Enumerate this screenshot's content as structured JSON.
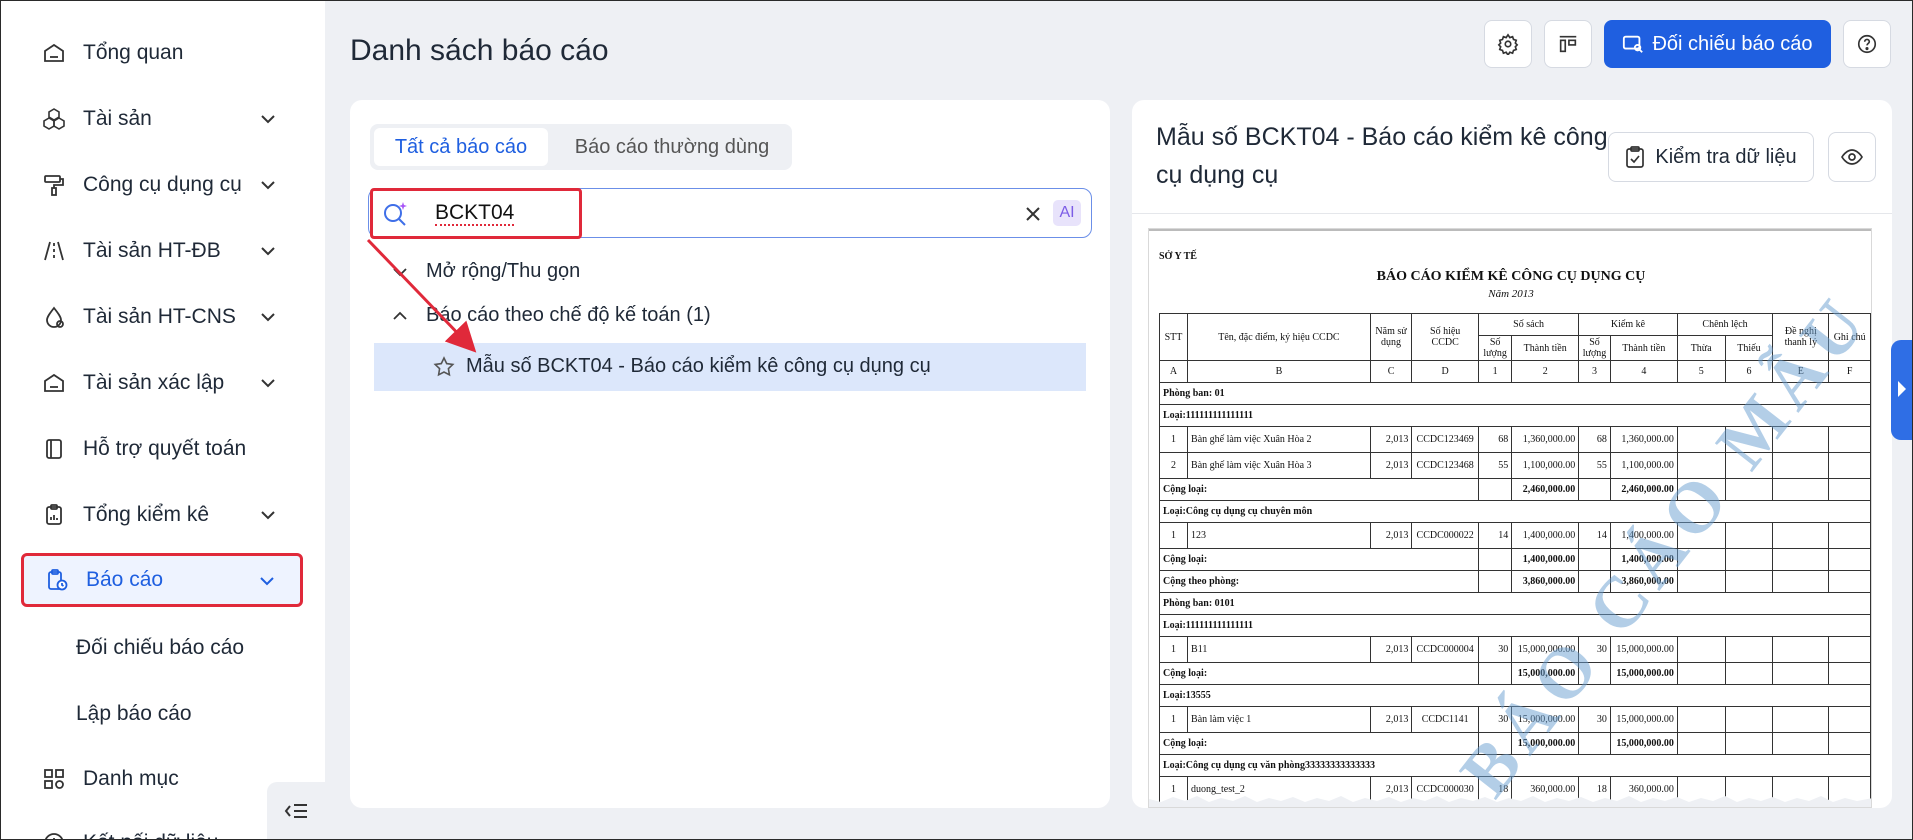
{
  "sidebar": {
    "items": [
      {
        "label": "Tổng quan",
        "icon": "home-icon"
      },
      {
        "label": "Tài sản",
        "icon": "cubes-icon"
      },
      {
        "label": "Công cụ dụng cụ",
        "icon": "paint-roller-icon"
      },
      {
        "label": "Tài sản HT-ĐB",
        "icon": "road-icon"
      },
      {
        "label": "Tài sản HT-CNS",
        "icon": "water-drop-icon"
      },
      {
        "label": "Tài sản xác lập",
        "icon": "house-icon"
      },
      {
        "label": "Hỗ trợ quyết toán",
        "icon": "notebook-icon"
      },
      {
        "label": "Tổng kiểm kê",
        "icon": "clipboard-chart-icon"
      },
      {
        "label": "Báo cáo",
        "icon": "report-clock-icon"
      },
      {
        "label": "Danh mục",
        "icon": "grid-icon"
      },
      {
        "label": "Kết nối dữ liệu",
        "icon": "clock-icon"
      }
    ],
    "sub_items": [
      "Đối chiếu báo cáo",
      "Lập báo cáo"
    ]
  },
  "header": {
    "title": "Danh sách báo cáo",
    "primary_button": "Đối chiếu báo cáo",
    "accent": "#1f5fe0"
  },
  "left_panel": {
    "tabs": [
      "Tất cả báo cáo",
      "Báo cáo thường dùng"
    ],
    "search": {
      "value": "BCKT04",
      "ai_label": "AI"
    },
    "tree": {
      "expand_label": "Mở rộng/Thu gọn",
      "group_label": "Báo cáo theo chế độ kế toán (1)",
      "item_label": "Mẫu số BCKT04 - Báo cáo kiểm kê công cụ dụng cụ"
    }
  },
  "right_panel": {
    "title": "Mẫu số BCKT04 - Báo cáo kiểm kê công cụ dụng cụ",
    "check_button": "Kiểm tra dữ liệu",
    "preview": {
      "org": "SỞ Y TẾ",
      "title": "BÁO CÁO KIỂM KÊ CÔNG CỤ DỤNG CỤ",
      "year": "Năm 2013",
      "watermark": "BÁO CÁO MẪU",
      "headers": {
        "stt": "STT",
        "name": "Tên, đặc điểm, ký hiệu CCDC",
        "year_used": "Năm sử dụng",
        "code": "Số hiệu CCDC",
        "book": "Số sách",
        "check": "Kiểm kê",
        "diff": "Chênh lệch",
        "proposal": "Đề nghị thanh lý",
        "note": "Ghi chú",
        "qty": "Số lượng",
        "amount": "Thành tiền",
        "surplus": "Thừa",
        "shortage": "Thiếu"
      },
      "letters": [
        "A",
        "B",
        "C",
        "D",
        "1",
        "2",
        "3",
        "4",
        "5",
        "6",
        "E",
        "F"
      ],
      "rows": [
        {
          "type": "group",
          "text": "Phòng ban: 01"
        },
        {
          "type": "group",
          "text": "Loại:111111111111111"
        },
        {
          "type": "item",
          "stt": "1",
          "name": "Bàn ghế làm việc Xuân Hòa 2",
          "year": "2,013",
          "code": "CCDC123469",
          "bq": "68",
          "ba": "1,360,000.00",
          "cq": "68",
          "ca": "1,360,000.00"
        },
        {
          "type": "item",
          "stt": "2",
          "name": "Bàn ghế làm việc Xuân Hòa 3",
          "year": "2,013",
          "code": "CCDC123468",
          "bq": "55",
          "ba": "1,100,000.00",
          "cq": "55",
          "ca": "1,100,000.00"
        },
        {
          "type": "sum",
          "text": "Cộng loại:",
          "ba": "2,460,000.00",
          "ca": "2,460,000.00"
        },
        {
          "type": "group",
          "text": "Loại:Công cụ dụng cụ chuyên môn"
        },
        {
          "type": "item",
          "stt": "1",
          "name": "123",
          "year": "2,013",
          "code": "CCDC000022",
          "bq": "14",
          "ba": "1,400,000.00",
          "cq": "14",
          "ca": "1,400,000.00"
        },
        {
          "type": "sum",
          "text": "Cộng loại:",
          "ba": "1,400,000.00",
          "ca": "1,400,000.00"
        },
        {
          "type": "sum",
          "text": "Cộng theo phòng:",
          "ba": "3,860,000.00",
          "ca": "3,860,000.00"
        },
        {
          "type": "group",
          "text": "Phòng ban: 0101"
        },
        {
          "type": "group",
          "text": "Loại:111111111111111"
        },
        {
          "type": "item",
          "stt": "1",
          "name": "B11",
          "year": "2,013",
          "code": "CCDC000004",
          "bq": "30",
          "ba": "15,000,000.00",
          "cq": "30",
          "ca": "15,000,000.00"
        },
        {
          "type": "sum",
          "text": "Cộng loại:",
          "ba": "15,000,000.00",
          "ca": "15,000,000.00"
        },
        {
          "type": "group",
          "text": "Loại:13555"
        },
        {
          "type": "item",
          "stt": "1",
          "name": "Bàn làm việc 1",
          "year": "2,013",
          "code": "CCDC1141",
          "bq": "30",
          "ba": "15,000,000.00",
          "cq": "30",
          "ca": "15,000,000.00"
        },
        {
          "type": "sum",
          "text": "Cộng loại:",
          "ba": "15,000,000.00",
          "ca": "15,000,000.00"
        },
        {
          "type": "group",
          "text": "Loại:Công cụ dụng cụ văn phòng33333333333333"
        },
        {
          "type": "item",
          "stt": "1",
          "name": "duong_test_2",
          "year": "2,013",
          "code": "CCDC000030",
          "bq": "18",
          "ba": "360,000.00",
          "cq": "18",
          "ca": "360,000.00"
        }
      ]
    }
  }
}
